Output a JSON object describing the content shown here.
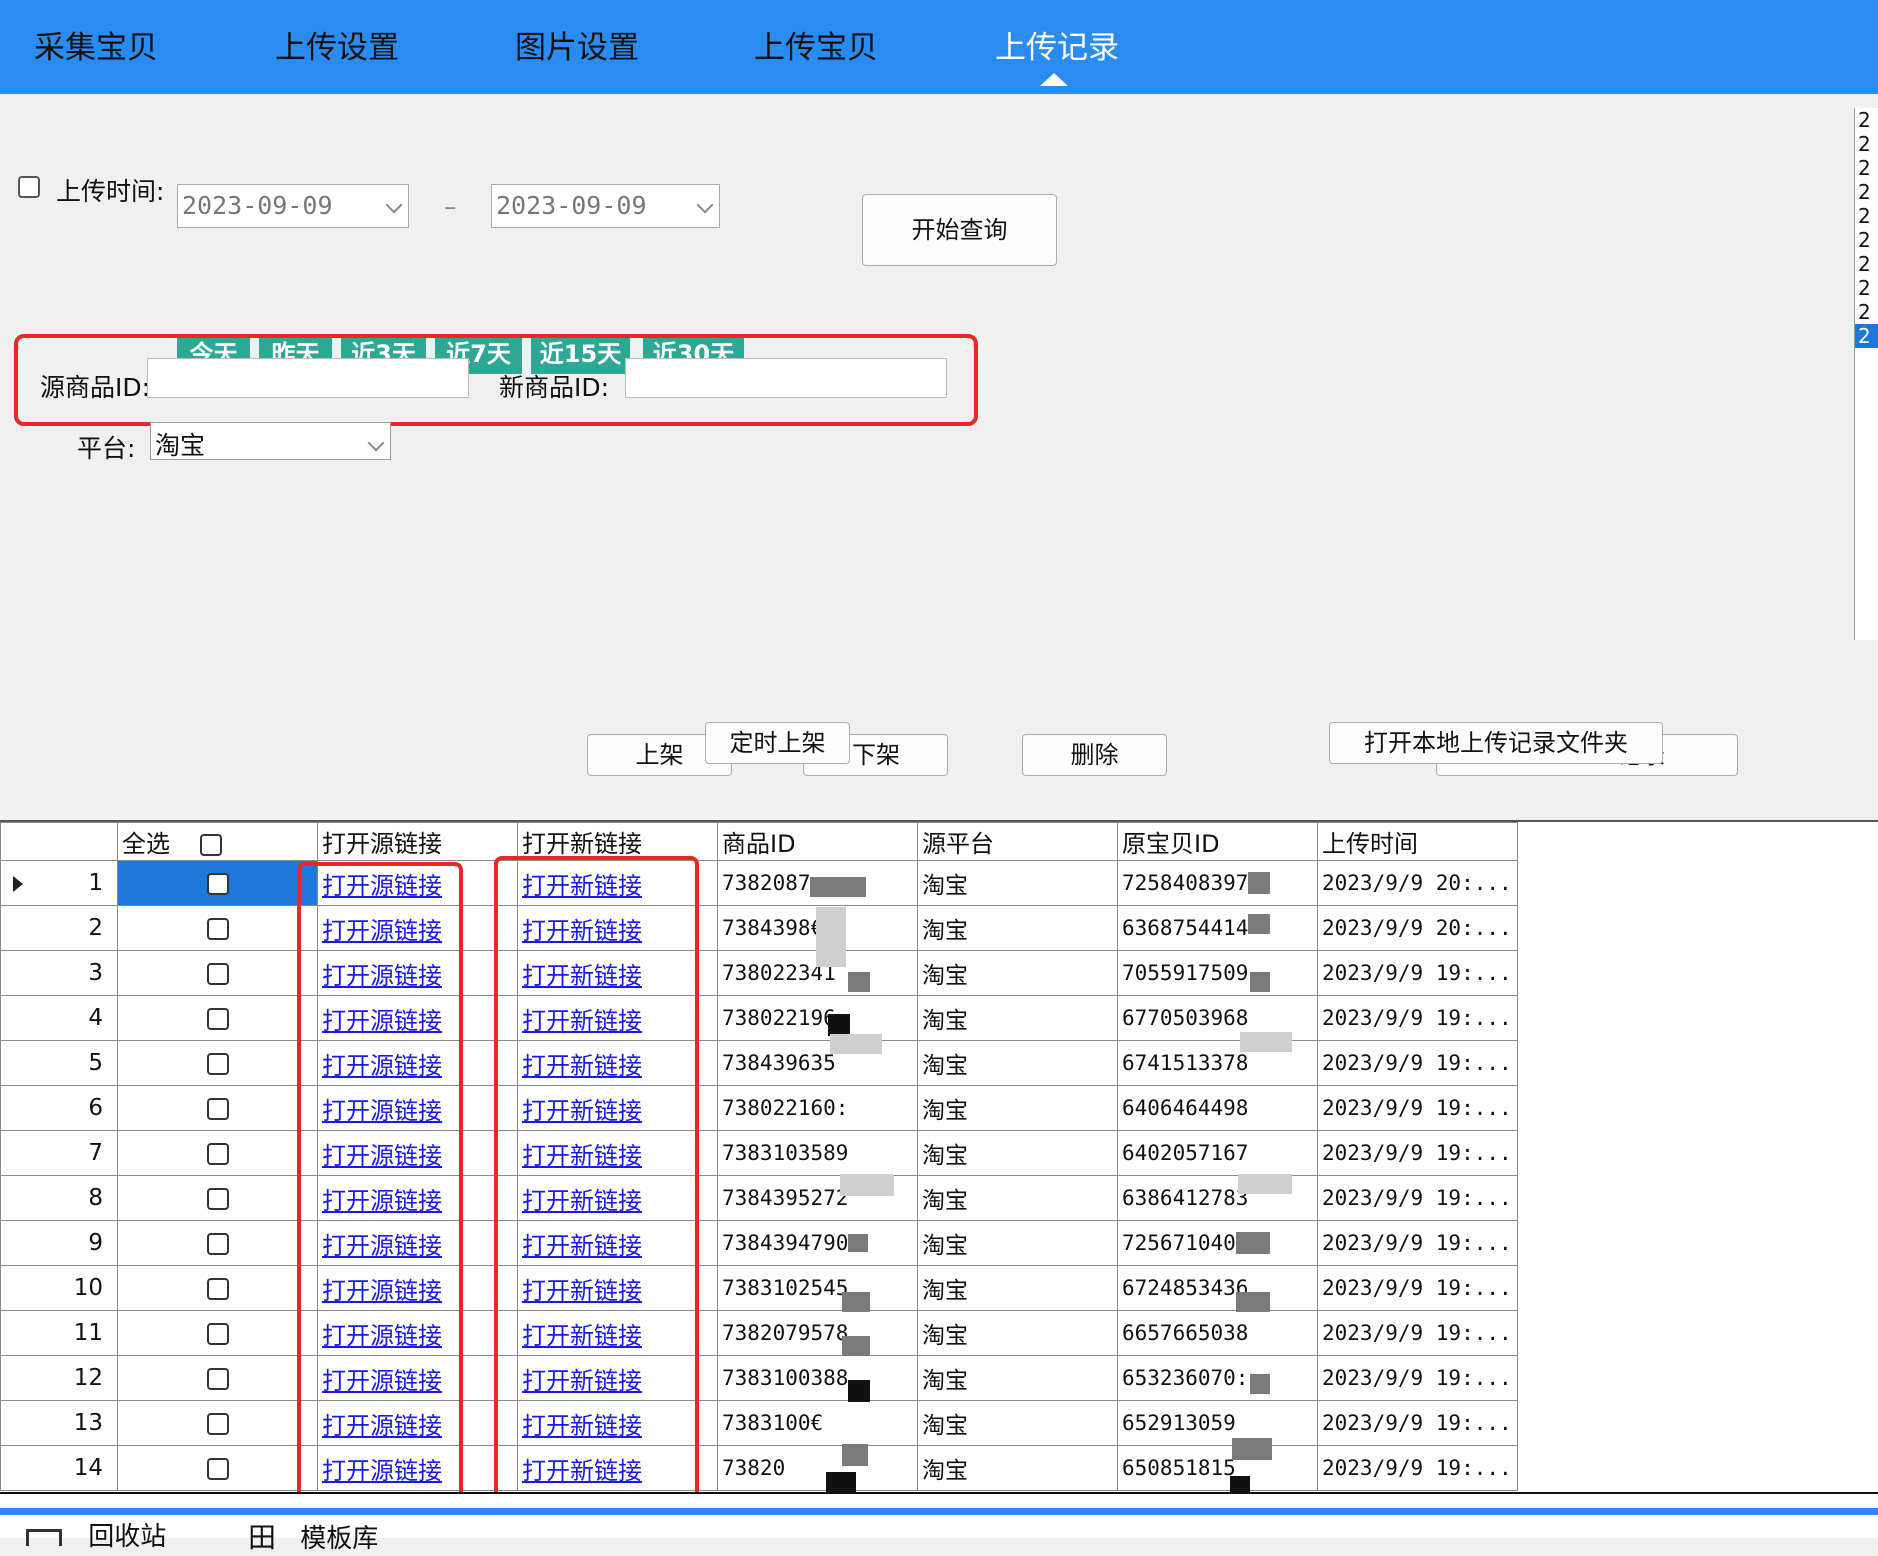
{
  "nav": {
    "tabs": [
      "采集宝贝",
      "上传设置",
      "图片设置",
      "上传宝贝",
      "上传记录"
    ],
    "active": "上传记录"
  },
  "filter": {
    "upload_time_label": "上传时间:",
    "start_date": "2023-09-09",
    "dash": "–",
    "end_date": "2023-09-09",
    "quick_ranges": [
      "今天",
      "昨天",
      "近3天",
      "近7天",
      "近15天",
      "近30天"
    ],
    "query_button": "开始查询",
    "source_id_label": "源商品ID:",
    "source_id_value": "",
    "new_id_label": "新商品ID:",
    "new_id_value": "",
    "platform_label": "平台:",
    "platform_value": "淘宝"
  },
  "right_list": {
    "items": [
      "2",
      "2",
      "2",
      "2",
      "2",
      "2",
      "2",
      "2",
      "2",
      "2"
    ],
    "selected_index": 9
  },
  "actions": {
    "list_on": "上架",
    "scheduled_on": "定时上架",
    "list_off": "下架",
    "delete": "删除",
    "open_folder": "打开本地上传记录文件夹",
    "record_partial": "记录"
  },
  "grid": {
    "columns": [
      "",
      "全选",
      "打开源链接",
      "打开新链接",
      "商品ID",
      "源平台",
      "原宝贝ID",
      "上传时间"
    ],
    "rows": [
      {
        "no": "1",
        "src_link": "打开源链接",
        "new_link": "打开新链接",
        "item_id": "7382087",
        "platform": "淘宝",
        "orig_id": "72584083979",
        "time": "2023/9/9 20:..."
      },
      {
        "no": "2",
        "src_link": "打开源链接",
        "new_link": "打开新链接",
        "item_id": "7384398€",
        "platform": "淘宝",
        "orig_id": "6368754414",
        "time": "2023/9/9 20:..."
      },
      {
        "no": "3",
        "src_link": "打开源链接",
        "new_link": "打开新链接",
        "item_id": "738022341",
        "platform": "淘宝",
        "orig_id": "7055917509",
        "time": "2023/9/9 19:..."
      },
      {
        "no": "4",
        "src_link": "打开源链接",
        "new_link": "打开新链接",
        "item_id": "738022196",
        "platform": "淘宝",
        "orig_id": "6770503968",
        "time": "2023/9/9 19:..."
      },
      {
        "no": "5",
        "src_link": "打开源链接",
        "new_link": "打开新链接",
        "item_id": "738439635",
        "platform": "淘宝",
        "orig_id": "6741513378",
        "time": "2023/9/9 19:..."
      },
      {
        "no": "6",
        "src_link": "打开源链接",
        "new_link": "打开新链接",
        "item_id": "738022160:",
        "platform": "淘宝",
        "orig_id": "6406464498",
        "time": "2023/9/9 19:..."
      },
      {
        "no": "7",
        "src_link": "打开源链接",
        "new_link": "打开新链接",
        "item_id": "7383103589",
        "platform": "淘宝",
        "orig_id": "6402057167",
        "time": "2023/9/9 19:..."
      },
      {
        "no": "8",
        "src_link": "打开源链接",
        "new_link": "打开新链接",
        "item_id": "7384395272",
        "platform": "淘宝",
        "orig_id": "6386412783",
        "time": "2023/9/9 19:..."
      },
      {
        "no": "9",
        "src_link": "打开源链接",
        "new_link": "打开新链接",
        "item_id": "7384394790",
        "platform": "淘宝",
        "orig_id": "7256710407",
        "time": "2023/9/9 19:..."
      },
      {
        "no": "10",
        "src_link": "打开源链接",
        "new_link": "打开新链接",
        "item_id": "7383102545",
        "platform": "淘宝",
        "orig_id": "6724853436",
        "time": "2023/9/9 19:..."
      },
      {
        "no": "11",
        "src_link": "打开源链接",
        "new_link": "打开新链接",
        "item_id": "7382079578",
        "platform": "淘宝",
        "orig_id": "6657665038",
        "time": "2023/9/9 19:..."
      },
      {
        "no": "12",
        "src_link": "打开源链接",
        "new_link": "打开新链接",
        "item_id": "7383100388",
        "platform": "淘宝",
        "orig_id": "653236070:",
        "time": "2023/9/9 19:..."
      },
      {
        "no": "13",
        "src_link": "打开源链接",
        "new_link": "打开新链接",
        "item_id": "7383100€",
        "platform": "淘宝",
        "orig_id": "652913059",
        "time": "2023/9/9 19:..."
      },
      {
        "no": "14",
        "src_link": "打开源链接",
        "new_link": "打开新链接",
        "item_id": "73820",
        "platform": "淘宝",
        "orig_id": "650851815",
        "time": "2023/9/9 19:..."
      }
    ]
  },
  "bottom_tabs": [
    "回收站",
    "模板库"
  ],
  "colors": {
    "nav_bg": "#2a8cf0",
    "quick_btn": "#2ea795",
    "highlight_red": "#e52828",
    "selected_blue": "#1e78d7",
    "link": "#1a1ae6"
  }
}
